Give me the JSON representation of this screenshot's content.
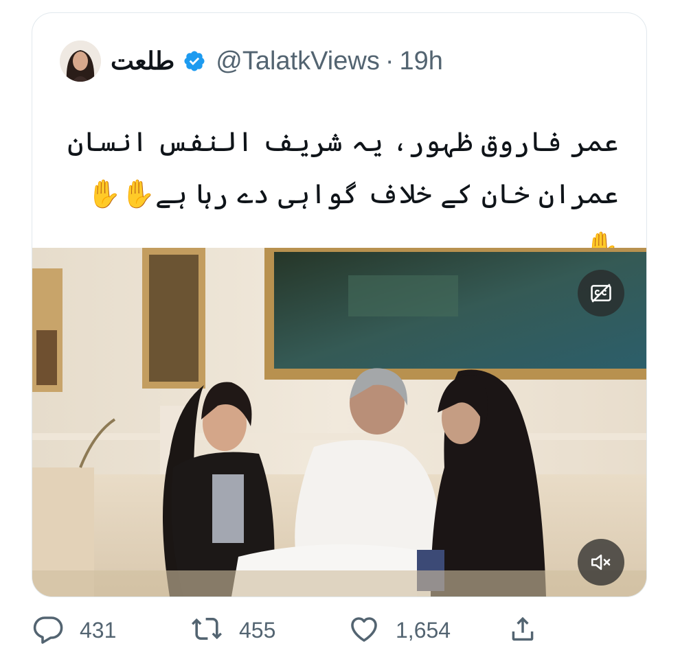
{
  "tweet": {
    "display_name": "طلعت",
    "handle": "@TalatkViews",
    "separator": "·",
    "time": "19h",
    "text": "عمر فاروق ظہور، یہ شریف النفس انسان عمران خان کے خلاف گواہی دے رہا ہے✋✋✋",
    "verified_color": "#1d9bf0"
  },
  "media": {
    "cc_icon": "captions-off-icon",
    "mute_icon": "volume-muted-icon"
  },
  "actions": {
    "reply_count": "431",
    "retweet_count": "455",
    "like_count": "1,654",
    "icons": [
      "reply-icon",
      "retweet-icon",
      "like-icon",
      "share-icon"
    ]
  }
}
